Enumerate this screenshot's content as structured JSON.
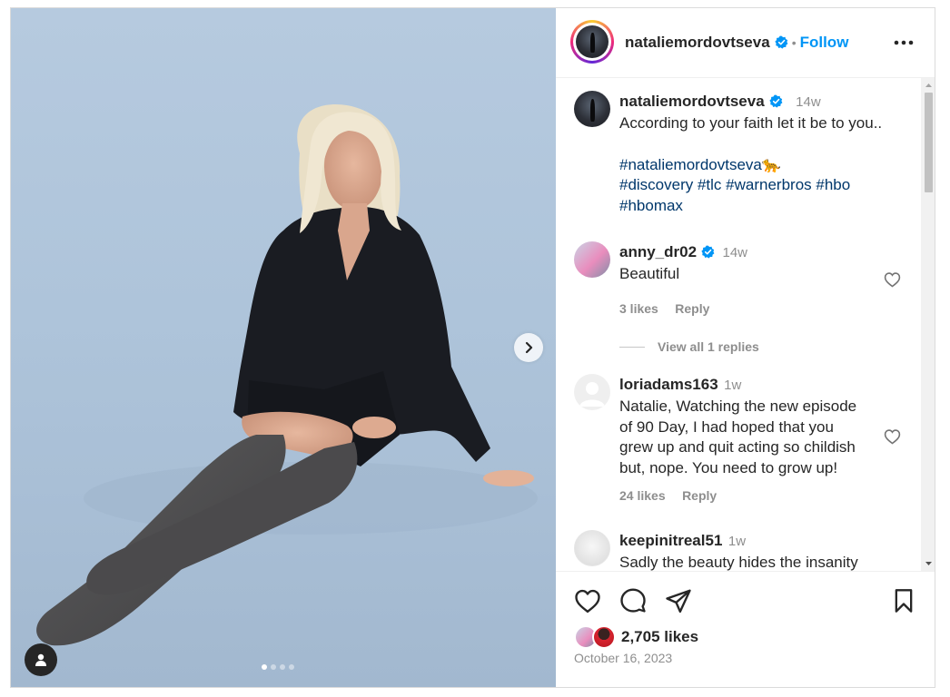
{
  "post": {
    "author": "nataliemordovtseva",
    "separator": "•",
    "follow_label": "Follow",
    "caption": {
      "username": "nataliemordovtseva",
      "age": "14w",
      "text": "According to your faith let it be to you..",
      "hashtag_line1": "#nataliemordovtseva🐆",
      "hashtag_line2": "#discovery #tlc #warnerbros #hbo",
      "hashtag_line3": "#hbomax"
    },
    "carousel": {
      "count": 4,
      "active": 1
    },
    "likes": "2,705 likes",
    "date": "October 16, 2023"
  },
  "comments": [
    {
      "username": "anny_dr02",
      "verified": true,
      "age": "14w",
      "lines": [
        "Beautiful"
      ],
      "likes": "3 likes",
      "reply": "Reply",
      "view_replies": "View all 1 replies"
    },
    {
      "username": "loriadams163",
      "verified": false,
      "age": "1w",
      "lines": [
        "Natalie, Watching the new episode",
        "of 90 Day, I had hoped that you",
        "grew up and quit acting so childish",
        "but, nope. You need to grow up!"
      ],
      "likes": "24 likes",
      "reply": "Reply"
    },
    {
      "username": "keepinitreal51",
      "verified": false,
      "age": "1w",
      "lines": [
        "Sadly the beauty hides the insanity"
      ]
    }
  ],
  "icons": {
    "more": "more-horizontal-icon",
    "like": "heart-icon",
    "comment": "comment-icon",
    "share": "share-icon",
    "save": "bookmark-icon",
    "verified": "verified-badge-icon",
    "next": "chevron-right-icon",
    "tag": "user-tag-icon"
  },
  "colors": {
    "accent": "#0095f6",
    "hashtag": "#00376b",
    "muted": "#8e8e8e",
    "text": "#262626"
  }
}
